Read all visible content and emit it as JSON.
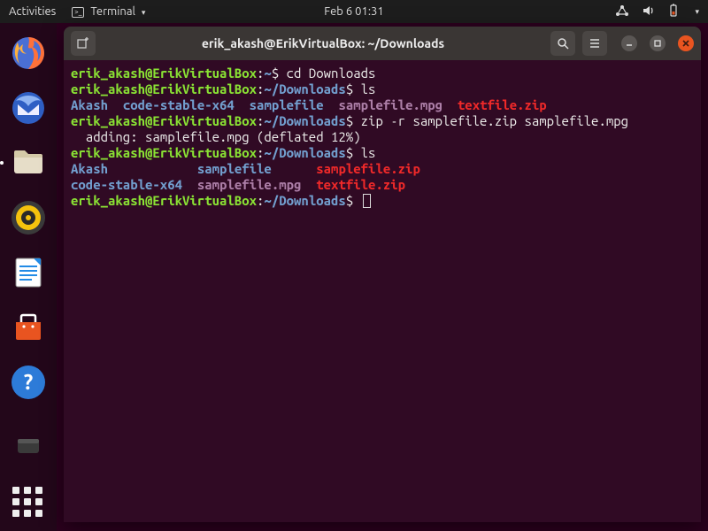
{
  "topbar": {
    "activities": "Activities",
    "app_label": "Terminal",
    "datetime": "Feb 6  01:31"
  },
  "dock": {
    "items": [
      {
        "name": "firefox-icon"
      },
      {
        "name": "thunderbird-icon"
      },
      {
        "name": "files-icon"
      },
      {
        "name": "rhythmbox-icon"
      },
      {
        "name": "libreoffice-writer-icon"
      },
      {
        "name": "ubuntu-software-icon"
      },
      {
        "name": "help-icon"
      }
    ]
  },
  "window": {
    "title": "erik_akash@ErikVirtualBox: ~/Downloads"
  },
  "prompt": {
    "user_host": "erik_akash@ErikVirtualBox",
    "home_path": "~",
    "downloads_path": "~/Downloads",
    "sigil": "$"
  },
  "lines": {
    "cmd_cd": "cd Downloads",
    "cmd_ls1": "ls",
    "cmd_zip": "zip -r samplefile.zip samplefile.mpg",
    "zip_out": "  adding: samplefile.mpg (deflated 12%)",
    "cmd_ls2": "ls"
  },
  "ls1": {
    "akash": "Akash",
    "code": "code-stable-x64",
    "samplefile": "samplefile",
    "mpg": "samplefile.mpg",
    "zip": "textfile.zip"
  },
  "ls2": {
    "row1": {
      "akash": "Akash",
      "samplefile": "samplefile",
      "samplezip": "samplefile.zip"
    },
    "row2": {
      "code": "code-stable-x64",
      "mpg": "samplefile.mpg",
      "textzip": "textfile.zip"
    }
  }
}
